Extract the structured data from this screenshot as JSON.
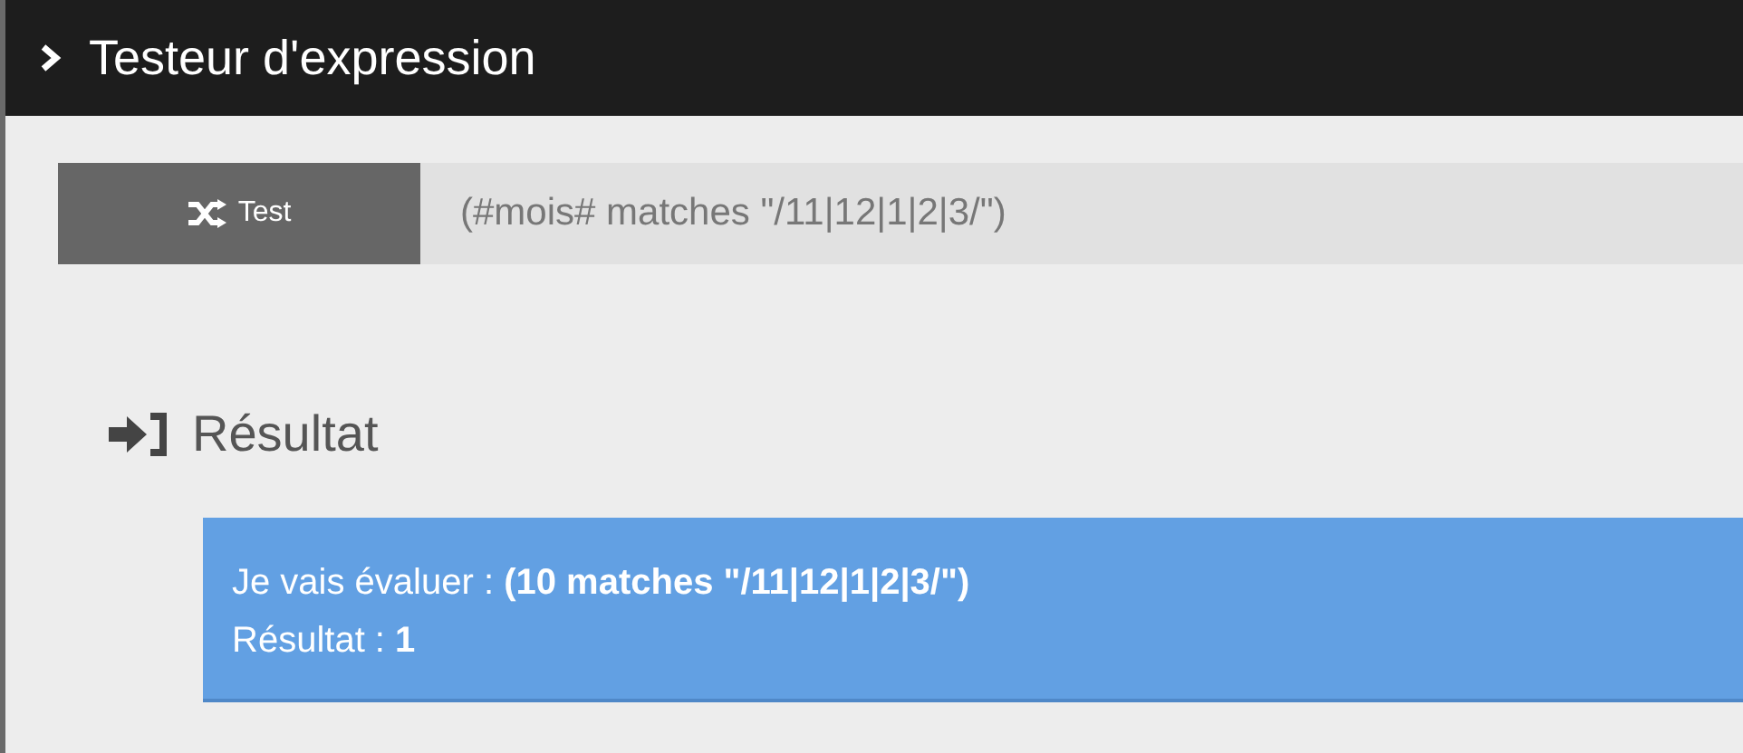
{
  "header": {
    "title": "Testeur d'expression"
  },
  "test_button": {
    "label": "Test"
  },
  "expression_field": {
    "value": "(#mois# matches \"/11|12|1|2|3/\")"
  },
  "result": {
    "heading": "Résultat",
    "lines": [
      "Je vais évaluer : **(10 matches \"/11|12|1|2|3/\")**",
      "Résultat : **1**"
    ]
  }
}
